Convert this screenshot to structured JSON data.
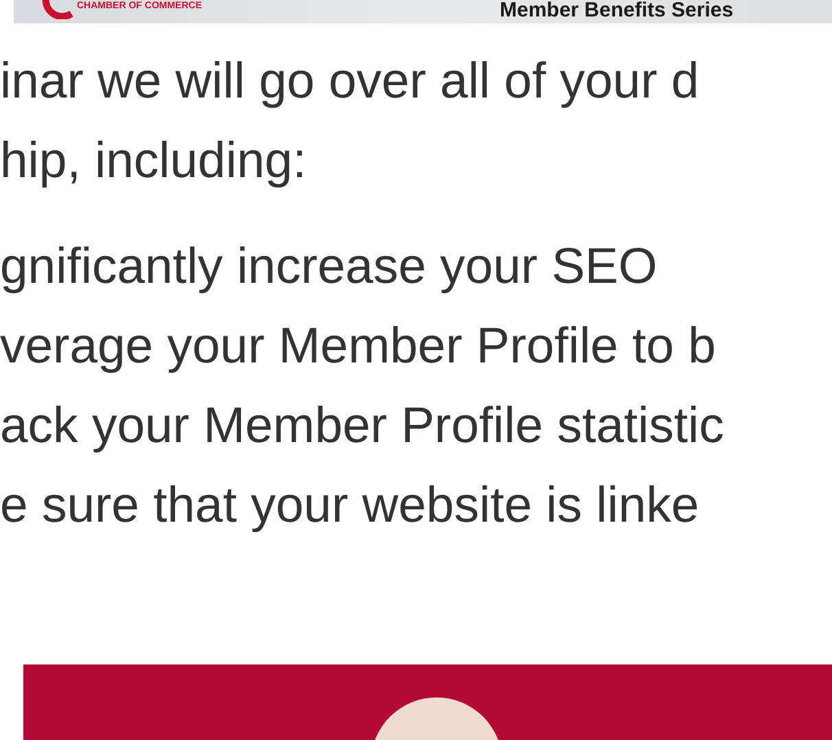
{
  "banner": {
    "organization": "CHAMBER OF COMMERCE",
    "series": "Member Benefits Series"
  },
  "intro": [
    "inar we will go over all of your d",
    "hip, including:"
  ],
  "list_items": [
    "gnificantly increase your SEO",
    "verage your Member Profile to b",
    "ack your Member Profile statistic",
    "e sure that your website is linke"
  ],
  "event_card": {
    "kind": "date-badge"
  }
}
